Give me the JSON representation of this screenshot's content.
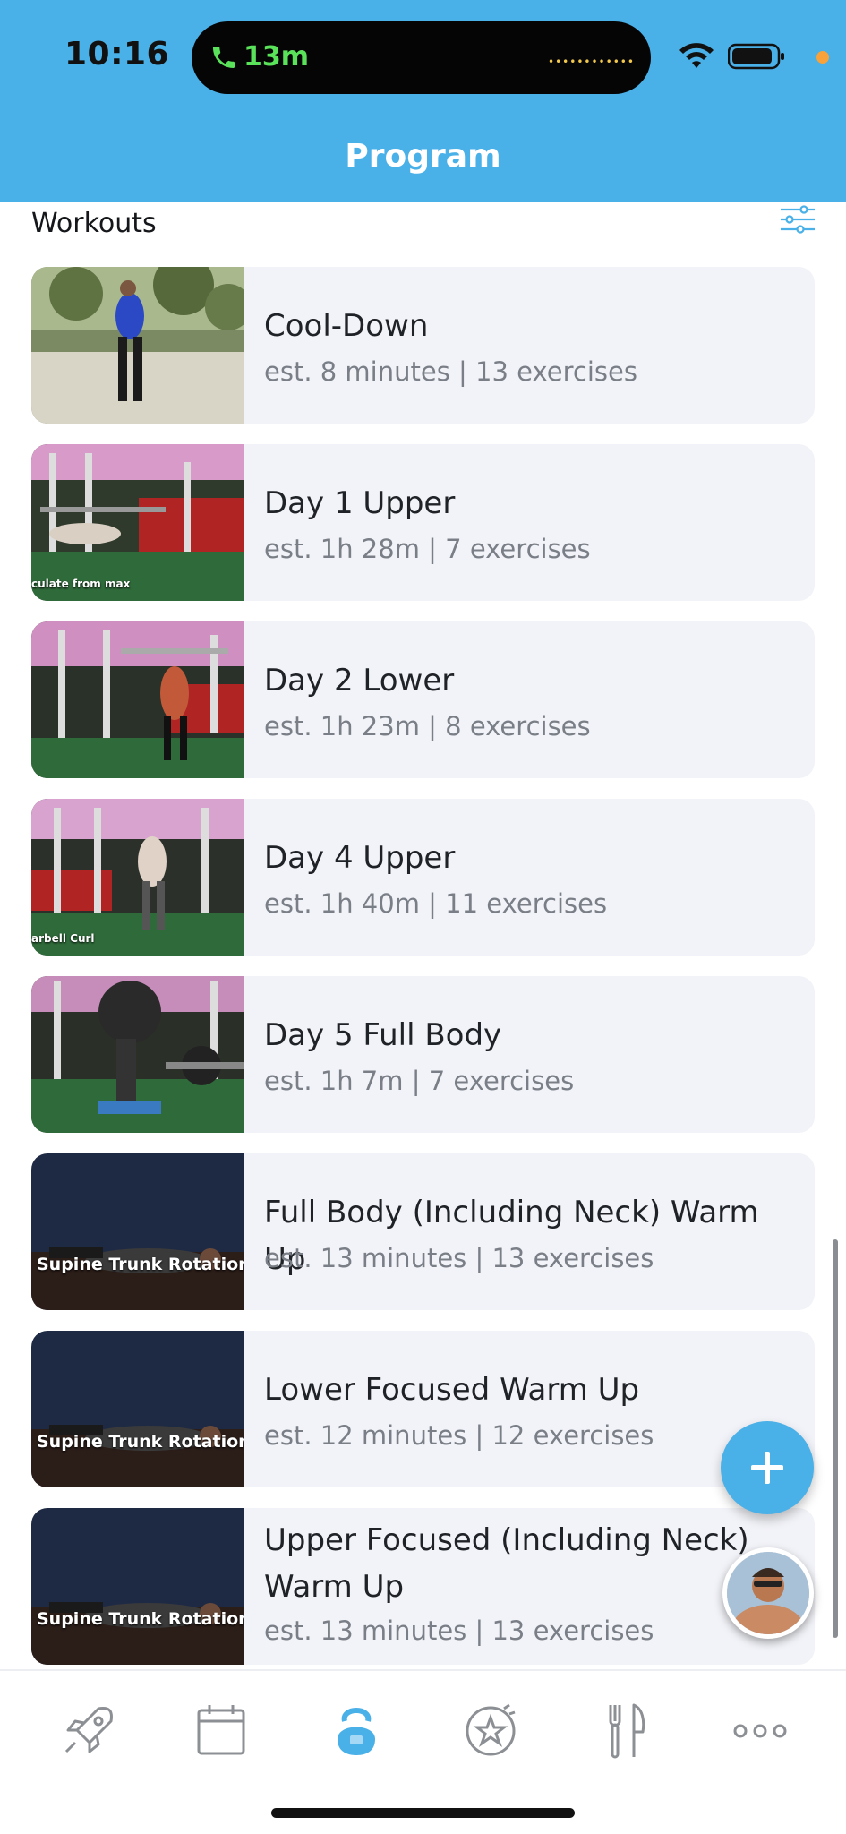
{
  "status_bar": {
    "time": "10:16",
    "call_duration": "13m"
  },
  "header": {
    "title": "Program"
  },
  "section": {
    "label": "Workouts"
  },
  "workouts": [
    {
      "title": "Cool-Down",
      "meta": "est. 8 minutes | 13 exercises",
      "thumb_caption": "",
      "thumb_sub": ""
    },
    {
      "title": "Day 1 Upper",
      "meta": "est. 1h 28m | 7 exercises",
      "thumb_caption": "",
      "thumb_sub": "culate from max"
    },
    {
      "title": "Day 2 Lower",
      "meta": "est. 1h 23m | 8 exercises",
      "thumb_caption": "",
      "thumb_sub": ""
    },
    {
      "title": "Day 4 Upper",
      "meta": "est. 1h 40m | 11 exercises",
      "thumb_caption": "",
      "thumb_sub": "arbell Curl"
    },
    {
      "title": "Day 5 Full Body",
      "meta": "est. 1h 7m | 7 exercises",
      "thumb_caption": "",
      "thumb_sub": ""
    },
    {
      "title": "Full Body (Including Neck) Warm Up",
      "meta": "est. 13 minutes | 13 exercises",
      "thumb_caption": "Supine Trunk Rotations",
      "thumb_sub": ""
    },
    {
      "title": "Lower Focused Warm Up",
      "meta": "est. 12 minutes | 12 exercises",
      "thumb_caption": "Supine Trunk Rotations",
      "thumb_sub": ""
    },
    {
      "title": "Upper Focused (Including Neck) Warm Up",
      "meta": "est. 13 minutes | 13 exercises",
      "thumb_caption": "Supine Trunk Rotations",
      "thumb_sub": ""
    }
  ],
  "tabs": [
    {
      "name": "rocket-icon",
      "active": false
    },
    {
      "name": "calendar-icon",
      "active": false
    },
    {
      "name": "kettlebell-icon",
      "active": true
    },
    {
      "name": "star-badge-icon",
      "active": false
    },
    {
      "name": "fork-knife-icon",
      "active": false
    },
    {
      "name": "more-dots-icon",
      "active": false
    }
  ],
  "colors": {
    "accent": "#4ab0e8",
    "card_bg": "#f2f3f8",
    "meta_text": "#7a7f87",
    "tab_inactive": "#8c8f93"
  }
}
